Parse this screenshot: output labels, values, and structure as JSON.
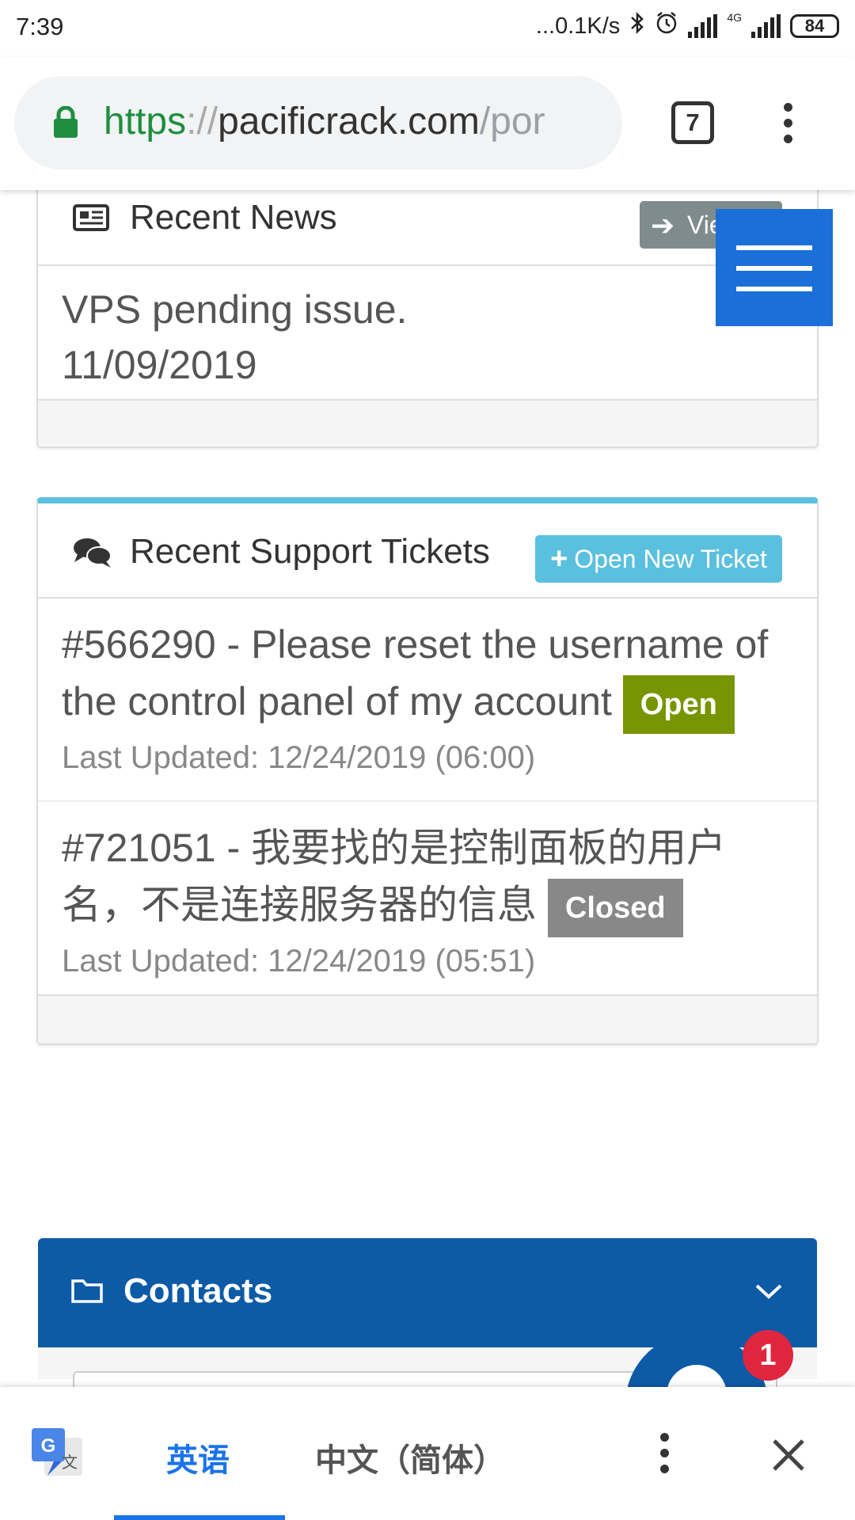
{
  "status_bar": {
    "time": "7:39",
    "net_speed": "...0.1K/s",
    "net_type": "4G",
    "battery": "84"
  },
  "browser": {
    "url_scheme": "https",
    "url_sep": "://",
    "url_host": "pacificrack.com",
    "url_rest": "/por",
    "tab_count": "7"
  },
  "news": {
    "title": "Recent News",
    "view_button": "Vie",
    "items": [
      {
        "headline": "VPS pending issue.",
        "date": "11/09/2019"
      }
    ]
  },
  "tickets": {
    "title": "Recent Support Tickets",
    "open_new_button": "Open New Ticket",
    "items": [
      {
        "subject": "#566290 - Please reset the username of the control panel of my account",
        "status": "Open",
        "updated": "Last Updated: 12/24/2019 (06:00)"
      },
      {
        "subject": "#721051 - 我要找的是控制面板的用户名，不是连接服务器的信息",
        "status": "Closed",
        "updated": "Last Updated: 12/24/2019 (05:51)"
      }
    ]
  },
  "contacts": {
    "title": "Contacts"
  },
  "chat": {
    "notification_count": "1"
  },
  "translate_bar": {
    "source_lang": "英语",
    "target_lang": "中文（简体）"
  },
  "colors": {
    "accent_blue": "#0d5aa7",
    "open_badge": "#779500",
    "closed_badge": "#888888",
    "info": "#5bc0de",
    "translate_active": "#1a73e8"
  }
}
